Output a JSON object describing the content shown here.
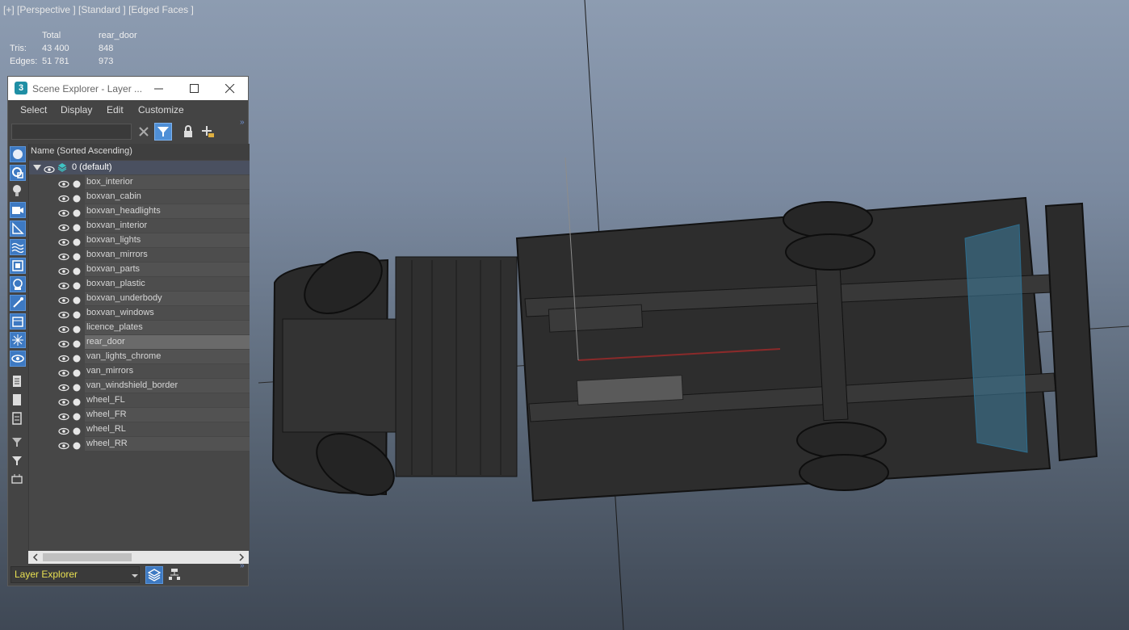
{
  "viewport": {
    "label": "[+] [Perspective ] [Standard ] [Edged Faces ]"
  },
  "stats": {
    "header_total": "Total",
    "header_object": "rear_door",
    "tris_label": "Tris:",
    "tris_total": "43 400",
    "tris_object": "848",
    "edges_label": "Edges:",
    "edges_total": "51 781",
    "edges_object": "973"
  },
  "window": {
    "app_icon": "3",
    "title": "Scene Explorer - Layer ...",
    "icons": [
      "minimize-icon",
      "maximize-icon",
      "close-icon"
    ]
  },
  "menu": {
    "items": [
      "Select",
      "Display",
      "Edit",
      "Customize"
    ]
  },
  "toolbar": {
    "search_value": "",
    "icons": [
      "clear-x-icon",
      "filter-icon",
      "lock-icon",
      "add-layer-icon"
    ]
  },
  "tree": {
    "column_header": "Name (Sorted Ascending)",
    "root": "0 (default)",
    "items": [
      "box_interior",
      "boxvan_cabin",
      "boxvan_headlights",
      "boxvan_interior",
      "boxvan_lights",
      "boxvan_mirrors",
      "boxvan_parts",
      "boxvan_plastic",
      "boxvan_underbody",
      "boxvan_windows",
      "licence_plates",
      "rear_door",
      "van_lights_chrome",
      "van_mirrors",
      "van_windshield_border",
      "wheel_FL",
      "wheel_FR",
      "wheel_RL",
      "wheel_RR"
    ],
    "selected": "rear_door"
  },
  "bottom": {
    "explorer_name": "Layer Explorer"
  },
  "colors": {
    "accent": "#4f8fd6",
    "selection_text": "#e8e052",
    "selected_row": "#6a6a6a",
    "viewport_top": "#8d9cb1",
    "viewport_bottom": "#3f4855"
  }
}
